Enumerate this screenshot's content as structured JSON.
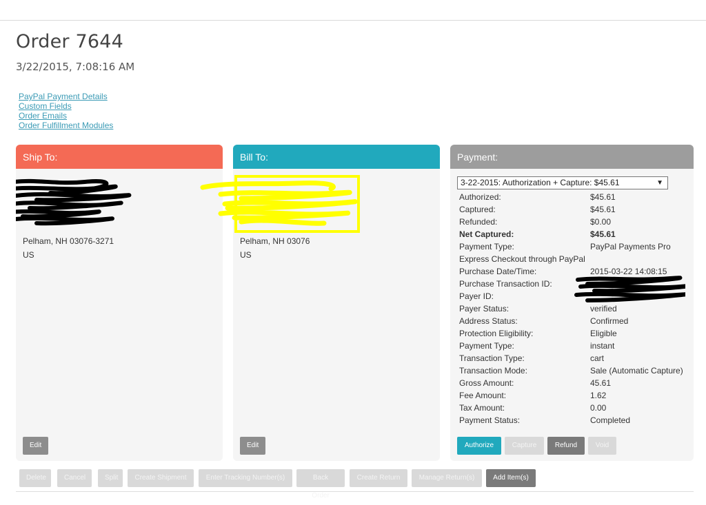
{
  "order": {
    "title": "Order 7644",
    "date": "3/22/2015, 7:08:16 AM"
  },
  "links": [
    "PayPal Payment Details",
    "Custom Fields",
    "Order Emails",
    "Order Fulfillment Modules"
  ],
  "ship": {
    "header": "Ship To:",
    "city": "Pelham, NH 03076-3271",
    "country": "US",
    "edit_label": "Edit"
  },
  "bill": {
    "header": "Bill To:",
    "city": "Pelham, NH 03076",
    "country": "US",
    "edit_label": "Edit"
  },
  "payment": {
    "header": "Payment:",
    "selected_transaction": "3-22-2015: Authorization + Capture: $45.61",
    "rows": [
      {
        "label": "Authorized:",
        "value": "$45.61"
      },
      {
        "label": "Captured:",
        "value": "$45.61"
      },
      {
        "label": "Refunded:",
        "value": "$0.00"
      },
      {
        "label": "Net Captured:",
        "value": "$45.61"
      },
      {
        "label": "Payment Type:",
        "value": "PayPal Payments Pro"
      },
      {
        "label": "Express Checkout through PayPal",
        "value": ""
      },
      {
        "label": "Purchase Date/Time:",
        "value": "2015-03-22 14:08:15"
      },
      {
        "label": "Purchase Transaction ID:",
        "value": ""
      },
      {
        "label": "Payer ID:",
        "value": ""
      },
      {
        "label": "Payer Status:",
        "value": "verified"
      },
      {
        "label": "Address Status:",
        "value": "Confirmed"
      },
      {
        "label": "Protection Eligibility:",
        "value": "Eligible"
      },
      {
        "label": "Payment Type:",
        "value": "instant"
      },
      {
        "label": "Transaction Type:",
        "value": "cart"
      },
      {
        "label": "Transaction Mode:",
        "value": "Sale (Automatic Capture)"
      },
      {
        "label": "Gross Amount:",
        "value": "45.61"
      },
      {
        "label": "Fee Amount:",
        "value": "1.62"
      },
      {
        "label": "Tax Amount:",
        "value": "0.00"
      },
      {
        "label": "Payment Status:",
        "value": "Completed"
      }
    ],
    "buttons": {
      "authorize": "Authorize",
      "capture": "Capture",
      "refund": "Refund",
      "void": "Void"
    }
  },
  "actions": {
    "delete": "Delete",
    "cancel": "Cancel",
    "split": "Split",
    "create_shipment": "Create Shipment",
    "enter_tracking": "Enter Tracking Number(s)",
    "back_order": "Back Order",
    "create_return": "Create Return",
    "manage_returns": "Manage Return(s)",
    "add_items": "Add Item(s)"
  },
  "colors": {
    "ship_header": "#f46a55",
    "bill_header": "#21a9bd",
    "payment_header": "#9d9d9d",
    "link": "#3a9ab5"
  }
}
